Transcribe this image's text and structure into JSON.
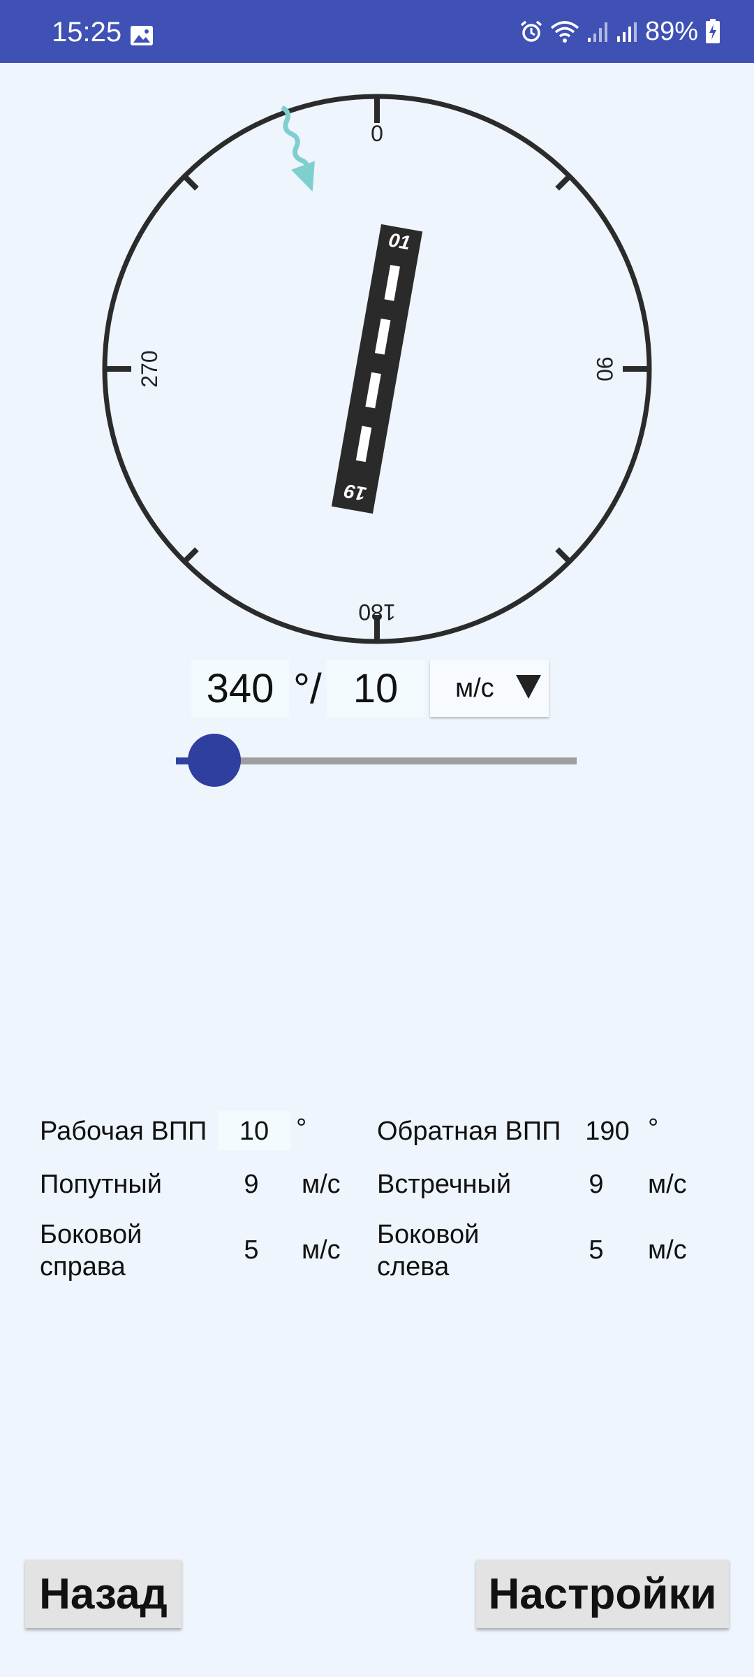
{
  "status_bar": {
    "time": "15:25",
    "battery": "89%",
    "icons": [
      "image-icon",
      "alarm-icon",
      "wifi-icon",
      "signal-icon",
      "signal-icon",
      "battery-charging-icon"
    ]
  },
  "compass": {
    "labels": {
      "north": "0",
      "east": "90",
      "south": "180",
      "west": "270"
    },
    "runway": {
      "heading_deg": 10,
      "end_a": "01",
      "end_b": "19"
    },
    "wind_direction_deg": 340,
    "wind_arrow_color": "#7fcfcf"
  },
  "wind_input": {
    "direction": "340",
    "separator": "°/",
    "speed": "10",
    "unit": "м/с",
    "slider_level": 0.1
  },
  "results": {
    "working_runway": {
      "label": "Рабочая ВПП",
      "value": "10",
      "unit": "°"
    },
    "reverse_runway": {
      "label": "Обратная ВПП",
      "value": "190",
      "unit": "°"
    },
    "tailwind": {
      "label": "Попутный",
      "value": "9",
      "unit": "м/с"
    },
    "headwind": {
      "label": "Встречный",
      "value": "9",
      "unit": "м/с"
    },
    "cross_right": {
      "label_line1": "Боковой",
      "label_line2": "справа",
      "value": "5",
      "unit": "м/с"
    },
    "cross_left": {
      "label_line1": "Боковой",
      "label_line2": "слева",
      "value": "5",
      "unit": "м/с"
    }
  },
  "buttons": {
    "back": "Назад",
    "settings": "Настройки"
  },
  "colors": {
    "status_bar": "#3f51b5",
    "slider_thumb": "#2f3fa0",
    "background": "#eef5fd"
  }
}
